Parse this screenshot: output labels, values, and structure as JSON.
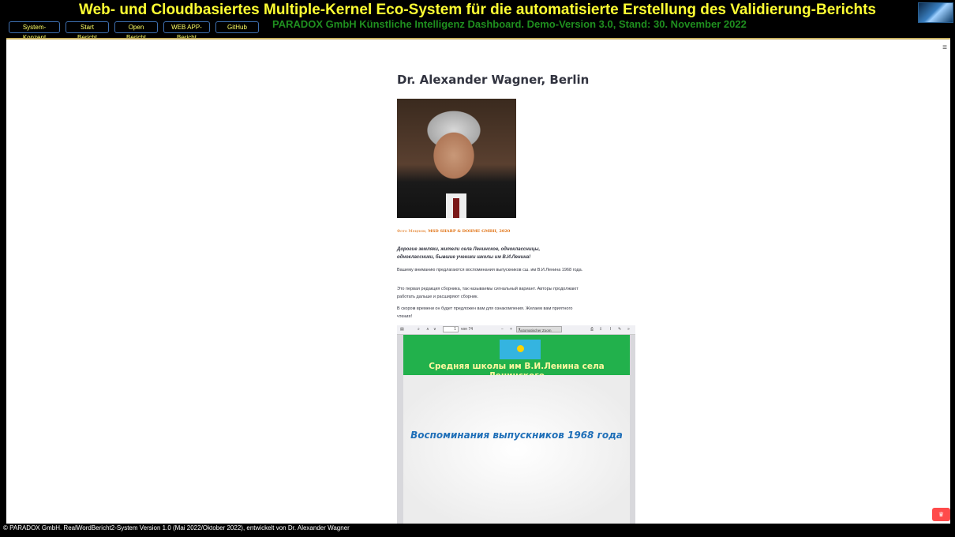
{
  "header": {
    "title": "Web- und Cloudbasiertes Multiple-Kernel Eco-System für die automatisierte Erstellung des Validierung-Berichts",
    "subtitle": "PARADOX GmbH Künstliche Intelligenz Dashboard. Demo-Version 3.0, Stand: 30. November 2022",
    "nav": [
      "System-Konzept",
      "Start Bericht",
      "Open Bericht",
      "WEB APP-Bericht",
      "GitHub"
    ]
  },
  "content": {
    "name": "Dr. Alexander Wagner, Berlin",
    "photo_caption_prefix": "Фото Мецпом,",
    "photo_caption_company": "MSD SHARP & DOHME GMBH, 2020",
    "greeting": "Дорогие земляки, жители села Ленинское, одноклассницы, одноклассники, бывшие ученики школы им В.И.Ленина!",
    "paragraphs": [
      "Вашему вниманию предлагаются воспоминания выпускников сш. им В.И.Ленина 1968 года.",
      "Это первая редакция сборника, так называемы сигнальный вариант. Авторы продолжают работать дальше и расширяют сборник.",
      "В скором времени он будет предложен вам для ознакомления. Желаем вам приятного чтения!"
    ]
  },
  "pdf_viewer": {
    "page_number": "1",
    "page_total": "von 74",
    "zoom": "Automatischer Zoom",
    "banner_text": "Средняя школы им В.И.Ленина села Ленинского",
    "document_title": "Воспоминания выпускников 1968 года"
  },
  "footer": "© PARADOX GmbH. RealWordBericht2-System Version 1.0 (Mai 2022/Oktober 2022), entwickelt von Dr. Alexander Wagner",
  "colors": {
    "title": "#ffff33",
    "subtitle": "#1f8f1f",
    "banner": "#22b14c",
    "doc_title": "#1f6fb8",
    "accent": "#ff4b4b"
  }
}
